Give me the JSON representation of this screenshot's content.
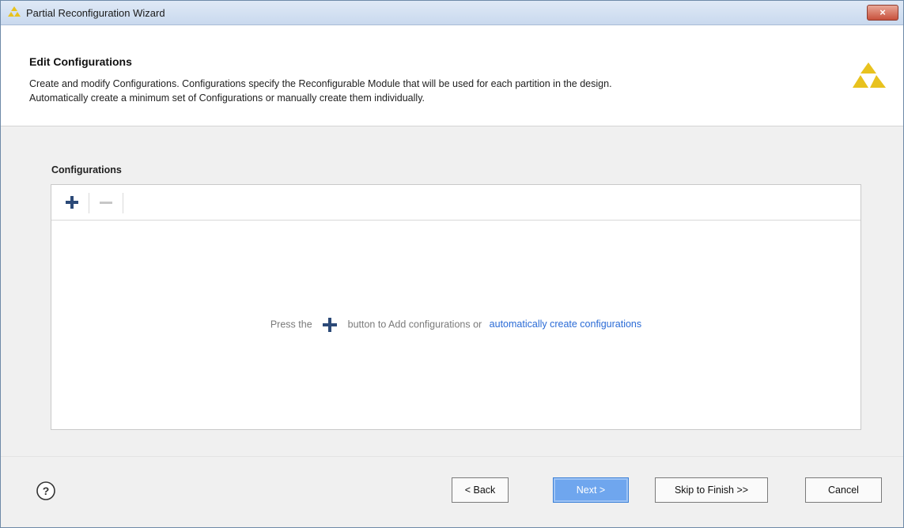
{
  "window": {
    "title": "Partial Reconfiguration Wizard",
    "close_label": "×"
  },
  "header": {
    "title": "Edit Configurations",
    "description_line1": "Create and modify Configurations. Configurations specify the Reconfigurable Module that will be used for each partition in the design.",
    "description_line2": "Automatically create a minimum set of Configurations or manually create them individually."
  },
  "configurations": {
    "label": "Configurations",
    "toolbar": {
      "add_icon": "plus-icon",
      "remove_icon": "minus-icon"
    },
    "empty_message": {
      "prefix": "Press the",
      "middle": "button to Add configurations or",
      "link": "automatically create configurations"
    }
  },
  "footer": {
    "help_icon": "question-circle-icon",
    "back_label": "< Back",
    "next_label": "Next >",
    "skip_label": "Skip to Finish >>",
    "cancel_label": "Cancel"
  },
  "colors": {
    "accent": "#2a6bd6",
    "primary_button": "#6fa6ee",
    "logo": "#e8c21e"
  }
}
